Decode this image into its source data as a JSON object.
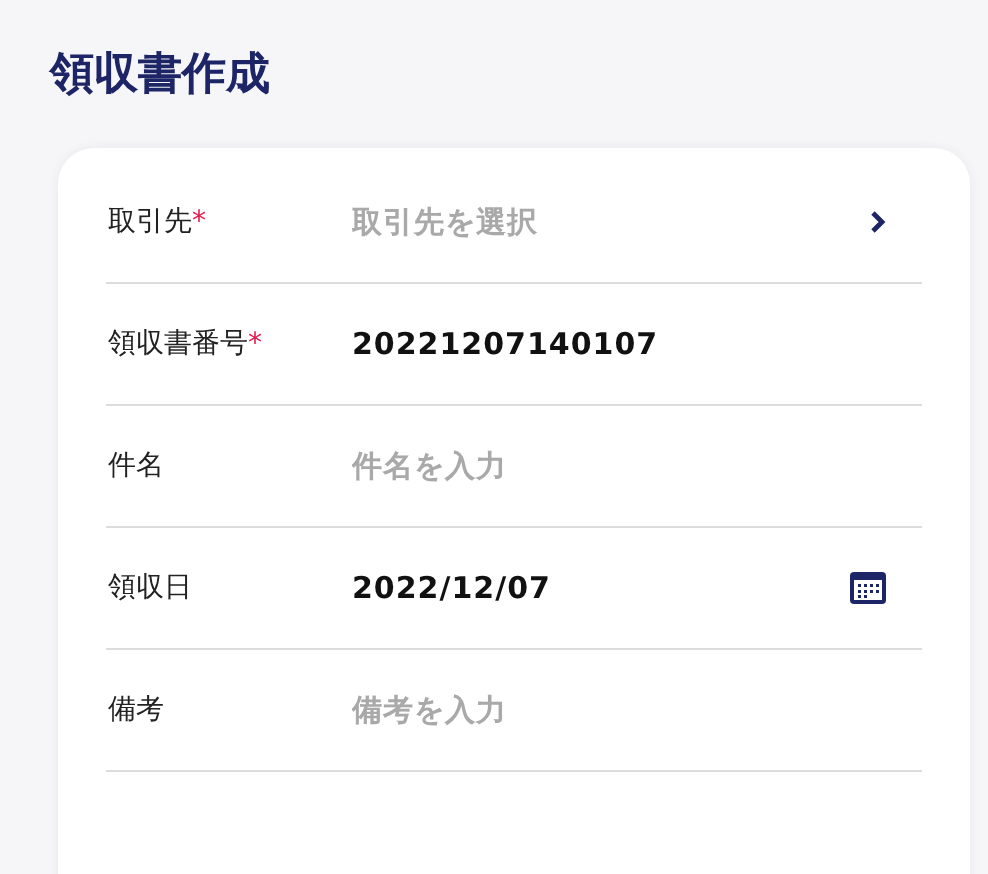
{
  "page_title": "領収書作成",
  "fields": [
    {
      "label": "取引先",
      "required_mark": "*",
      "kind": "select",
      "placeholder": "取引先を選択"
    },
    {
      "label": "領収書番号",
      "required_mark": "*",
      "kind": "text",
      "value": "20221207140107"
    },
    {
      "label": "件名",
      "kind": "text",
      "placeholder": "件名を入力"
    },
    {
      "label": "領収日",
      "kind": "date",
      "value": "2022/12/07"
    },
    {
      "label": "備考",
      "kind": "text",
      "placeholder": "備考を入力"
    }
  ]
}
